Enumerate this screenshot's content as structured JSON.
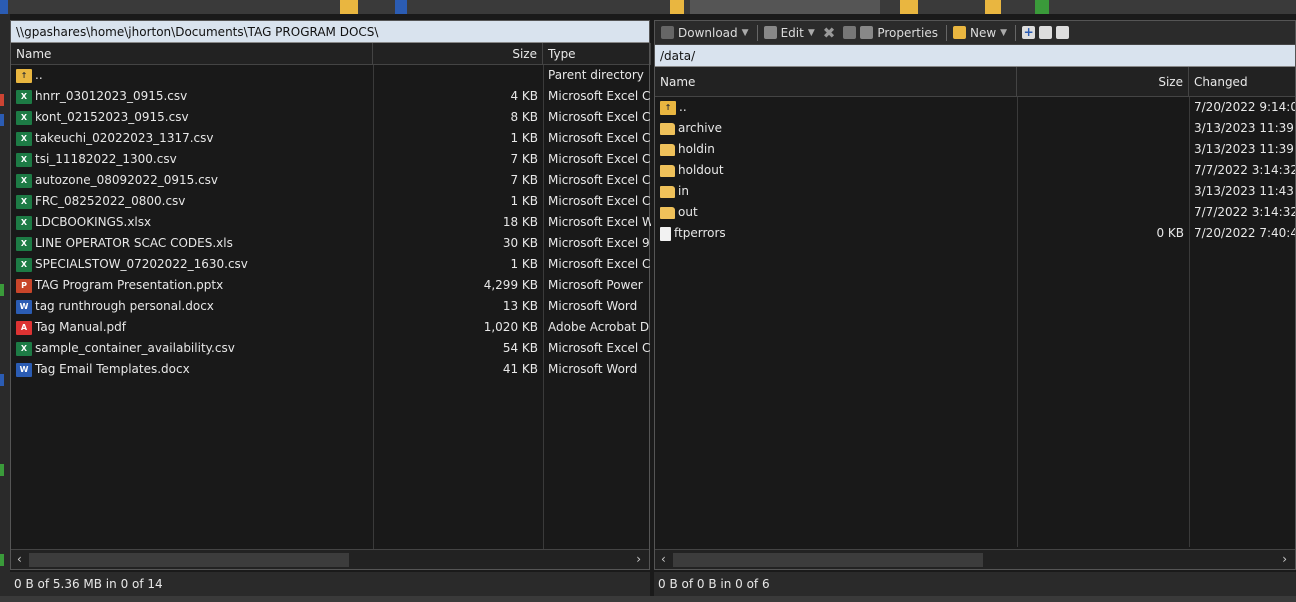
{
  "left": {
    "path": "\\\\gpashares\\home\\jhorton\\Documents\\TAG PROGRAM DOCS\\",
    "columns": {
      "name": "Name",
      "size": "Size",
      "type": "Type"
    },
    "rows": [
      {
        "name": "..",
        "size": "",
        "type": "Parent directory",
        "icon": "up-icon"
      },
      {
        "name": "hnrr_03012023_0915.csv",
        "size": "4 KB",
        "type": "Microsoft Excel C",
        "icon": "excel-icon"
      },
      {
        "name": "kont_02152023_0915.csv",
        "size": "8 KB",
        "type": "Microsoft Excel C",
        "icon": "excel-icon"
      },
      {
        "name": "takeuchi_02022023_1317.csv",
        "size": "1 KB",
        "type": "Microsoft Excel C",
        "icon": "excel-icon"
      },
      {
        "name": "tsi_11182022_1300.csv",
        "size": "7 KB",
        "type": "Microsoft Excel C",
        "icon": "excel-icon"
      },
      {
        "name": "autozone_08092022_0915.csv",
        "size": "7 KB",
        "type": "Microsoft Excel C",
        "icon": "excel-icon"
      },
      {
        "name": "FRC_08252022_0800.csv",
        "size": "1 KB",
        "type": "Microsoft Excel C",
        "icon": "excel-icon"
      },
      {
        "name": "LDCBOOKINGS.xlsx",
        "size": "18 KB",
        "type": "Microsoft Excel W",
        "icon": "excel-icon"
      },
      {
        "name": "LINE OPERATOR SCAC CODES.xls",
        "size": "30 KB",
        "type": "Microsoft Excel 9",
        "icon": "excel-icon"
      },
      {
        "name": "SPECIALSTOW_07202022_1630.csv",
        "size": "1 KB",
        "type": "Microsoft Excel C",
        "icon": "excel-icon"
      },
      {
        "name": "TAG Program Presentation.pptx",
        "size": "4,299 KB",
        "type": "Microsoft Power",
        "icon": "powerpoint-icon"
      },
      {
        "name": "tag runthrough personal.docx",
        "size": "13 KB",
        "type": "Microsoft Word",
        "icon": "word-icon"
      },
      {
        "name": "Tag Manual.pdf",
        "size": "1,020 KB",
        "type": "Adobe Acrobat D",
        "icon": "pdf-icon"
      },
      {
        "name": "sample_container_availability.csv",
        "size": "54 KB",
        "type": "Microsoft Excel C",
        "icon": "excel-icon"
      },
      {
        "name": "Tag Email Templates.docx",
        "size": "41 KB",
        "type": "Microsoft Word",
        "icon": "word-icon"
      }
    ],
    "status": "0 B of 5.36 MB in 0 of 14"
  },
  "right": {
    "toolbar": {
      "download": "Download",
      "edit": "Edit",
      "properties": "Properties",
      "new": "New"
    },
    "path": "/data/",
    "columns": {
      "name": "Name",
      "size": "Size",
      "changed": "Changed"
    },
    "rows": [
      {
        "name": "..",
        "size": "",
        "changed": "7/20/2022 9:14:0",
        "icon": "up-icon"
      },
      {
        "name": "archive",
        "size": "",
        "changed": "3/13/2023 11:39:5",
        "icon": "folder-icon"
      },
      {
        "name": "holdin",
        "size": "",
        "changed": "3/13/2023 11:39:5",
        "icon": "folder-icon"
      },
      {
        "name": "holdout",
        "size": "",
        "changed": "7/7/2022 3:14:32",
        "icon": "folder-icon"
      },
      {
        "name": "in",
        "size": "",
        "changed": "3/13/2023 11:43:2",
        "icon": "folder-icon"
      },
      {
        "name": "out",
        "size": "",
        "changed": "7/7/2022 3:14:32",
        "icon": "folder-icon"
      },
      {
        "name": "ftperrors",
        "size": "0 KB",
        "changed": "7/20/2022 7:40:4",
        "icon": "file-icon"
      }
    ],
    "status": "0 B of 0 B in 0 of 6"
  }
}
